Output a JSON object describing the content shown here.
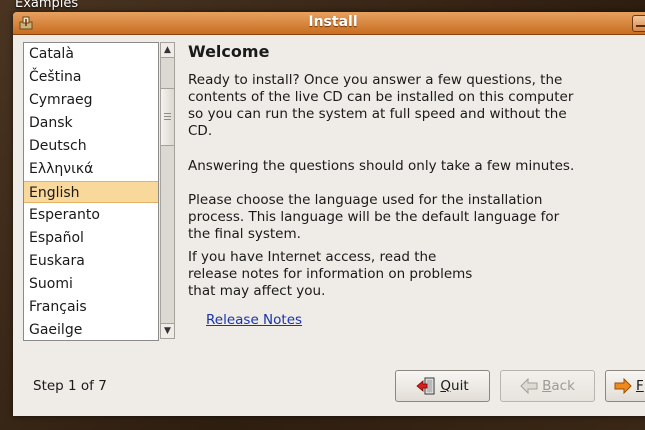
{
  "desktop": {
    "label": "Examples"
  },
  "window": {
    "title": "Install"
  },
  "languages": [
    "Català",
    "Čeština",
    "Cymraeg",
    "Dansk",
    "Deutsch",
    "Ελληνικά",
    "English",
    "Esperanto",
    "Español",
    "Euskara",
    "Suomi",
    "Français",
    "Gaeilge"
  ],
  "selected_language": "English",
  "content": {
    "heading": "Welcome",
    "para1": "Ready to install? Once you answer a few questions, the contents of the live CD can be installed on this computer so you can run the system at full speed and without the CD.",
    "para2": "Answering the questions should only take a few minutes.",
    "para3": "Please choose the language used for the installation process. This language will be the default language for the final system.",
    "para4": "If you have Internet access, read the release notes for information on problems that may affect you.",
    "release_notes": "Release Notes"
  },
  "footer": {
    "step": "Step 1 of 7",
    "quit_first": "Q",
    "quit_rest": "uit",
    "back_first": "B",
    "back_rest": "ack",
    "forward_first": "F"
  },
  "colors": {
    "titlebar": "#d9823a",
    "selection": "#f9d89c",
    "link": "#1a34a8"
  },
  "icons": {
    "title": "installer-icon",
    "quit": "quit-door-icon",
    "back": "back-arrow-icon",
    "forward": "forward-arrow-icon"
  }
}
